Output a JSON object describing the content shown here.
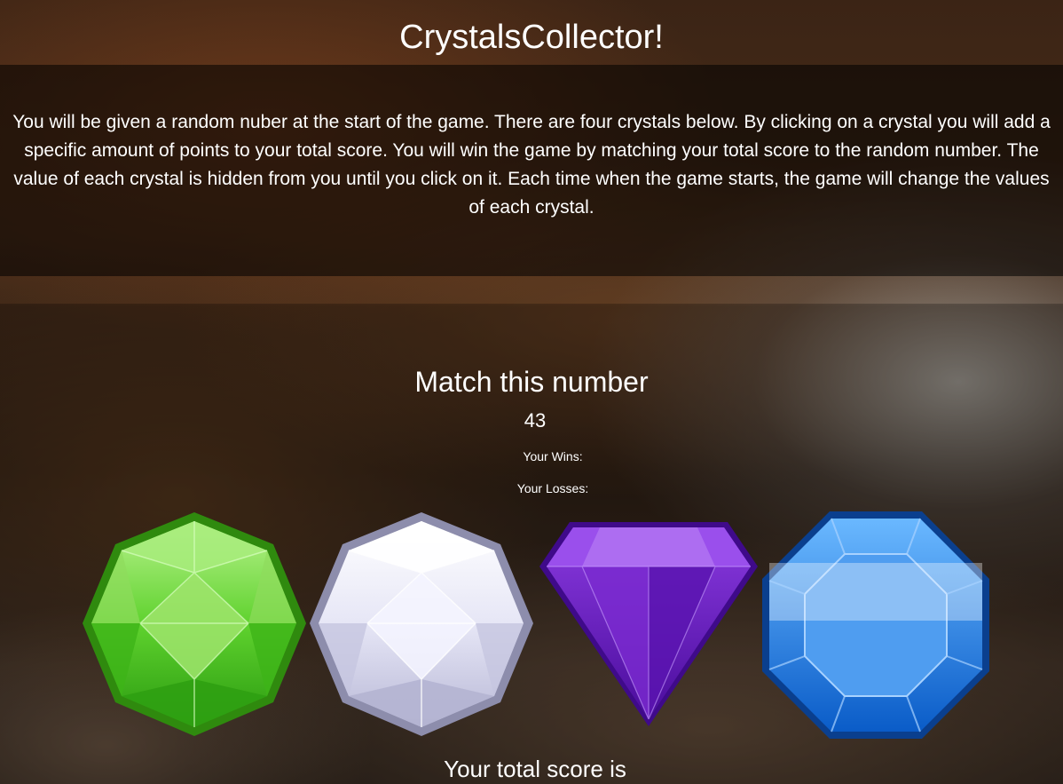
{
  "header": {
    "title": "CrystalsCollector!"
  },
  "instructions": {
    "text": "You will be given a random nuber at the start of the game. There are four crystals below. By clicking on a crystal you will add a specific amount of points to your total score. You will win the game by matching your total score to the random number. The value of each crystal is hidden from you until you click on it. Each time when the game starts, the game will change the values of each crystal."
  },
  "scoreboard": {
    "match_heading": "Match this number",
    "target_number": "43",
    "wins_label": "Your Wins:",
    "losses_label": "Your Losses:",
    "total_score_label": "Your total score is"
  },
  "crystals": [
    {
      "name": "green-crystal-icon",
      "color": "#3fbf1f"
    },
    {
      "name": "white-crystal-icon",
      "color": "#d8d8f0"
    },
    {
      "name": "purple-crystal-icon",
      "color": "#6a1fc0"
    },
    {
      "name": "blue-crystal-icon",
      "color": "#1a6fd8"
    }
  ]
}
